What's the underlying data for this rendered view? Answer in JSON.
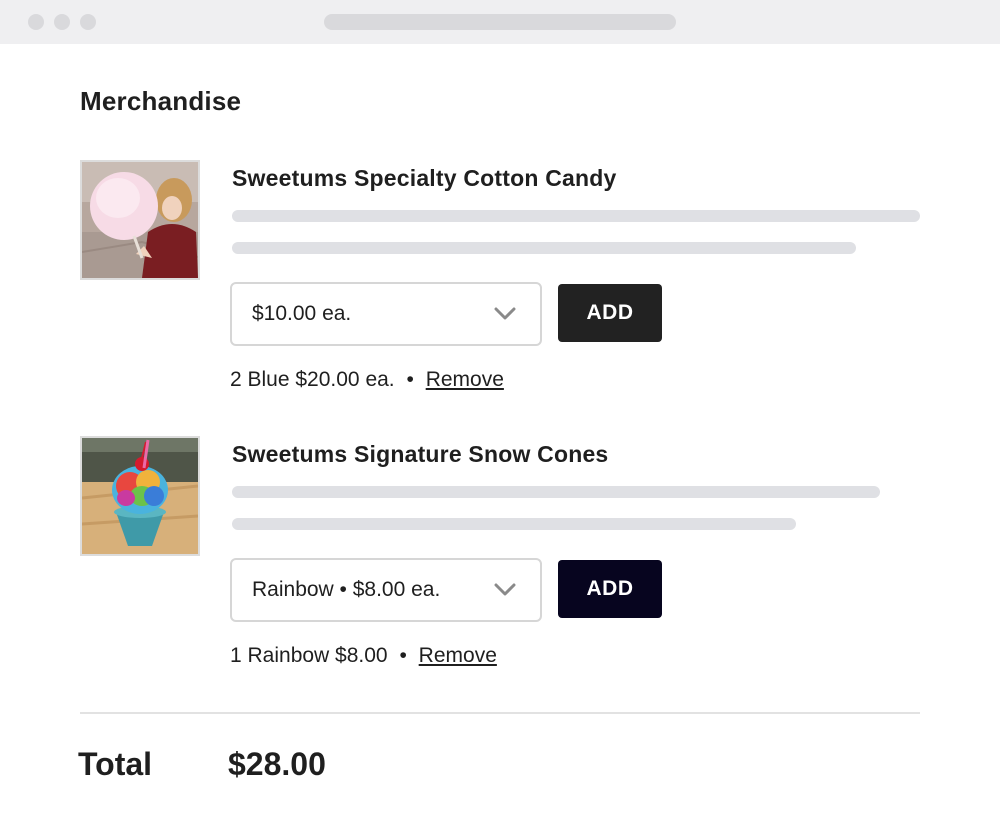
{
  "section_title": "Merchandise",
  "items": [
    {
      "title": "Sweetums Specialty Cotton Candy",
      "image_icon": "cotton-candy-photo",
      "select_value": "$10.00 ea.",
      "add_label": "ADD",
      "summary_text": "2 Blue $20.00 ea.",
      "separator": "•",
      "remove_label": "Remove"
    },
    {
      "title": "Sweetums Signature Snow Cones",
      "image_icon": "snow-cone-photo",
      "select_value": "Rainbow • $8.00 ea.",
      "add_label": "ADD",
      "summary_text": "1 Rainbow $8.00",
      "separator": "•",
      "remove_label": "Remove"
    }
  ],
  "total": {
    "label": "Total",
    "value": "$28.00"
  },
  "colors": {
    "add_button_1": "#222222",
    "add_button_2": "#07051f",
    "placeholder_line": "#dfe0e4"
  }
}
